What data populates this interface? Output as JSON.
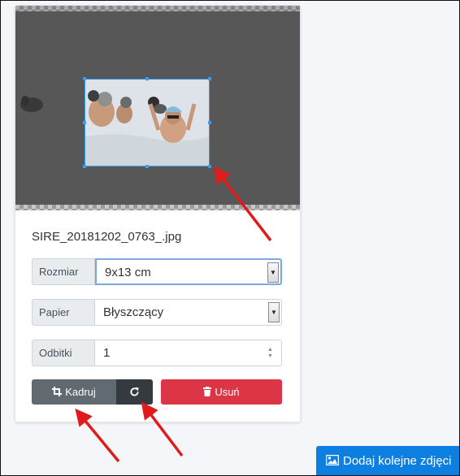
{
  "item": {
    "filename": "SIRE_20181202_0763_.jpg",
    "size": {
      "label": "Rozmiar",
      "value": "9x13 cm"
    },
    "paper": {
      "label": "Papier",
      "value": "Błyszczący"
    },
    "copies": {
      "label": "Odbitki",
      "value": "1"
    }
  },
  "actions": {
    "crop_label": "Kadruj",
    "rotate_icon": "rotate-icon",
    "delete_label": "Usuń"
  },
  "footer": {
    "add_label": "Dodaj kolejne zdjęci"
  },
  "colors": {
    "crop_button": "#616971",
    "rotate_button": "#343a40",
    "delete_button": "#dc3545",
    "add_button": "#0d7fe0",
    "crop_frame": "#3c9bf2",
    "annotation_arrow": "#e01b1b"
  }
}
